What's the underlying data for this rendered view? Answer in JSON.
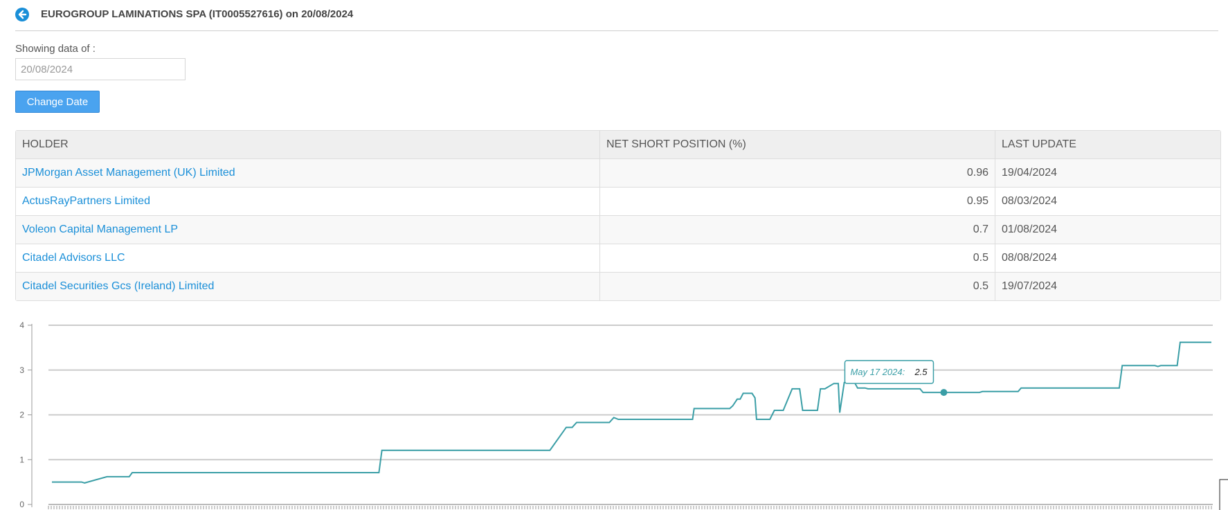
{
  "header": {
    "title": "EUROGROUP LAMINATIONS SPA (IT0005527616) on 20/08/2024",
    "back_icon": "arrow-left-circle-icon",
    "accent_color": "#1a8fd8"
  },
  "filter": {
    "label": "Showing data of :",
    "date_value": "20/08/2024",
    "button_label": "Change Date"
  },
  "table": {
    "columns": [
      "HOLDER",
      "NET SHORT POSITION (%)",
      "LAST UPDATE"
    ],
    "rows": [
      {
        "holder": "JPMorgan Asset Management (UK) Limited",
        "position": "0.96",
        "updated": "19/04/2024"
      },
      {
        "holder": "ActusRayPartners Limited",
        "position": "0.95",
        "updated": "08/03/2024"
      },
      {
        "holder": "Voleon Capital Management LP",
        "position": "0.7",
        "updated": "01/08/2024"
      },
      {
        "holder": "Citadel Advisors LLC",
        "position": "0.5",
        "updated": "08/08/2024"
      },
      {
        "holder": "Citadel Securities Gcs (Ireland) Limited",
        "position": "0.5",
        "updated": "19/07/2024"
      }
    ]
  },
  "chart_data": {
    "type": "line",
    "ylim": [
      0,
      4
    ],
    "y_ticks": [
      "0",
      "1",
      "2",
      "3",
      "4"
    ],
    "grid": true,
    "line_color": "#3a9ea6",
    "series": [
      {
        "values": [
          [
            0,
            0.5
          ],
          [
            20,
            0.5
          ],
          [
            22,
            0.48
          ],
          [
            37,
            0.62
          ],
          [
            52,
            0.62
          ],
          [
            54,
            0.71
          ],
          [
            220,
            0.71
          ],
          [
            222,
            1.21
          ],
          [
            335,
            1.21
          ],
          [
            346,
            1.72
          ],
          [
            350,
            1.72
          ],
          [
            353,
            1.83
          ],
          [
            375,
            1.83
          ],
          [
            378,
            1.94
          ],
          [
            381,
            1.9
          ],
          [
            431,
            1.9
          ],
          [
            432,
            2.14
          ],
          [
            456,
            2.14
          ],
          [
            458,
            2.2
          ],
          [
            461,
            2.35
          ],
          [
            463,
            2.35
          ],
          [
            465,
            2.48
          ],
          [
            471,
            2.48
          ],
          [
            473,
            2.38
          ],
          [
            474,
            1.9
          ],
          [
            483,
            1.9
          ],
          [
            486,
            2.1
          ],
          [
            492,
            2.1
          ],
          [
            498,
            2.58
          ],
          [
            503,
            2.58
          ],
          [
            505,
            2.1
          ],
          [
            515,
            2.1
          ],
          [
            517,
            2.58
          ],
          [
            520,
            2.58
          ],
          [
            526,
            2.7
          ],
          [
            529,
            2.7
          ],
          [
            530,
            2.05
          ],
          [
            533,
            2.72
          ],
          [
            540,
            2.72
          ],
          [
            542,
            2.6
          ],
          [
            547,
            2.6
          ],
          [
            549,
            2.58
          ],
          [
            584,
            2.58
          ],
          [
            586,
            2.5
          ],
          [
            624,
            2.5
          ],
          [
            626,
            2.52
          ],
          [
            650,
            2.52
          ],
          [
            652,
            2.6
          ],
          [
            718,
            2.6
          ],
          [
            720,
            3.1
          ],
          [
            742,
            3.1
          ],
          [
            744,
            3.08
          ],
          [
            746,
            3.1
          ],
          [
            757,
            3.1
          ],
          [
            759,
            3.62
          ],
          [
            780,
            3.62
          ]
        ]
      }
    ],
    "highlight": {
      "date": "May 17 2024:",
      "value": "2.5",
      "index": 600
    }
  }
}
